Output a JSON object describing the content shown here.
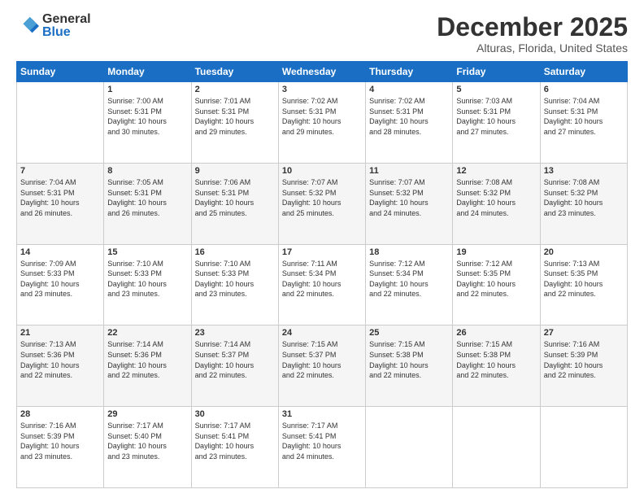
{
  "logo": {
    "general": "General",
    "blue": "Blue"
  },
  "header": {
    "month": "December 2025",
    "location": "Alturas, Florida, United States"
  },
  "days_of_week": [
    "Sunday",
    "Monday",
    "Tuesday",
    "Wednesday",
    "Thursday",
    "Friday",
    "Saturday"
  ],
  "weeks": [
    [
      {
        "day": "",
        "info": ""
      },
      {
        "day": "1",
        "info": "Sunrise: 7:00 AM\nSunset: 5:31 PM\nDaylight: 10 hours\nand 30 minutes."
      },
      {
        "day": "2",
        "info": "Sunrise: 7:01 AM\nSunset: 5:31 PM\nDaylight: 10 hours\nand 29 minutes."
      },
      {
        "day": "3",
        "info": "Sunrise: 7:02 AM\nSunset: 5:31 PM\nDaylight: 10 hours\nand 29 minutes."
      },
      {
        "day": "4",
        "info": "Sunrise: 7:02 AM\nSunset: 5:31 PM\nDaylight: 10 hours\nand 28 minutes."
      },
      {
        "day": "5",
        "info": "Sunrise: 7:03 AM\nSunset: 5:31 PM\nDaylight: 10 hours\nand 27 minutes."
      },
      {
        "day": "6",
        "info": "Sunrise: 7:04 AM\nSunset: 5:31 PM\nDaylight: 10 hours\nand 27 minutes."
      }
    ],
    [
      {
        "day": "7",
        "info": "Sunrise: 7:04 AM\nSunset: 5:31 PM\nDaylight: 10 hours\nand 26 minutes."
      },
      {
        "day": "8",
        "info": "Sunrise: 7:05 AM\nSunset: 5:31 PM\nDaylight: 10 hours\nand 26 minutes."
      },
      {
        "day": "9",
        "info": "Sunrise: 7:06 AM\nSunset: 5:31 PM\nDaylight: 10 hours\nand 25 minutes."
      },
      {
        "day": "10",
        "info": "Sunrise: 7:07 AM\nSunset: 5:32 PM\nDaylight: 10 hours\nand 25 minutes."
      },
      {
        "day": "11",
        "info": "Sunrise: 7:07 AM\nSunset: 5:32 PM\nDaylight: 10 hours\nand 24 minutes."
      },
      {
        "day": "12",
        "info": "Sunrise: 7:08 AM\nSunset: 5:32 PM\nDaylight: 10 hours\nand 24 minutes."
      },
      {
        "day": "13",
        "info": "Sunrise: 7:08 AM\nSunset: 5:32 PM\nDaylight: 10 hours\nand 23 minutes."
      }
    ],
    [
      {
        "day": "14",
        "info": "Sunrise: 7:09 AM\nSunset: 5:33 PM\nDaylight: 10 hours\nand 23 minutes."
      },
      {
        "day": "15",
        "info": "Sunrise: 7:10 AM\nSunset: 5:33 PM\nDaylight: 10 hours\nand 23 minutes."
      },
      {
        "day": "16",
        "info": "Sunrise: 7:10 AM\nSunset: 5:33 PM\nDaylight: 10 hours\nand 23 minutes."
      },
      {
        "day": "17",
        "info": "Sunrise: 7:11 AM\nSunset: 5:34 PM\nDaylight: 10 hours\nand 22 minutes."
      },
      {
        "day": "18",
        "info": "Sunrise: 7:12 AM\nSunset: 5:34 PM\nDaylight: 10 hours\nand 22 minutes."
      },
      {
        "day": "19",
        "info": "Sunrise: 7:12 AM\nSunset: 5:35 PM\nDaylight: 10 hours\nand 22 minutes."
      },
      {
        "day": "20",
        "info": "Sunrise: 7:13 AM\nSunset: 5:35 PM\nDaylight: 10 hours\nand 22 minutes."
      }
    ],
    [
      {
        "day": "21",
        "info": "Sunrise: 7:13 AM\nSunset: 5:36 PM\nDaylight: 10 hours\nand 22 minutes."
      },
      {
        "day": "22",
        "info": "Sunrise: 7:14 AM\nSunset: 5:36 PM\nDaylight: 10 hours\nand 22 minutes."
      },
      {
        "day": "23",
        "info": "Sunrise: 7:14 AM\nSunset: 5:37 PM\nDaylight: 10 hours\nand 22 minutes."
      },
      {
        "day": "24",
        "info": "Sunrise: 7:15 AM\nSunset: 5:37 PM\nDaylight: 10 hours\nand 22 minutes."
      },
      {
        "day": "25",
        "info": "Sunrise: 7:15 AM\nSunset: 5:38 PM\nDaylight: 10 hours\nand 22 minutes."
      },
      {
        "day": "26",
        "info": "Sunrise: 7:15 AM\nSunset: 5:38 PM\nDaylight: 10 hours\nand 22 minutes."
      },
      {
        "day": "27",
        "info": "Sunrise: 7:16 AM\nSunset: 5:39 PM\nDaylight: 10 hours\nand 22 minutes."
      }
    ],
    [
      {
        "day": "28",
        "info": "Sunrise: 7:16 AM\nSunset: 5:39 PM\nDaylight: 10 hours\nand 23 minutes."
      },
      {
        "day": "29",
        "info": "Sunrise: 7:17 AM\nSunset: 5:40 PM\nDaylight: 10 hours\nand 23 minutes."
      },
      {
        "day": "30",
        "info": "Sunrise: 7:17 AM\nSunset: 5:41 PM\nDaylight: 10 hours\nand 23 minutes."
      },
      {
        "day": "31",
        "info": "Sunrise: 7:17 AM\nSunset: 5:41 PM\nDaylight: 10 hours\nand 24 minutes."
      },
      {
        "day": "",
        "info": ""
      },
      {
        "day": "",
        "info": ""
      },
      {
        "day": "",
        "info": ""
      }
    ]
  ]
}
